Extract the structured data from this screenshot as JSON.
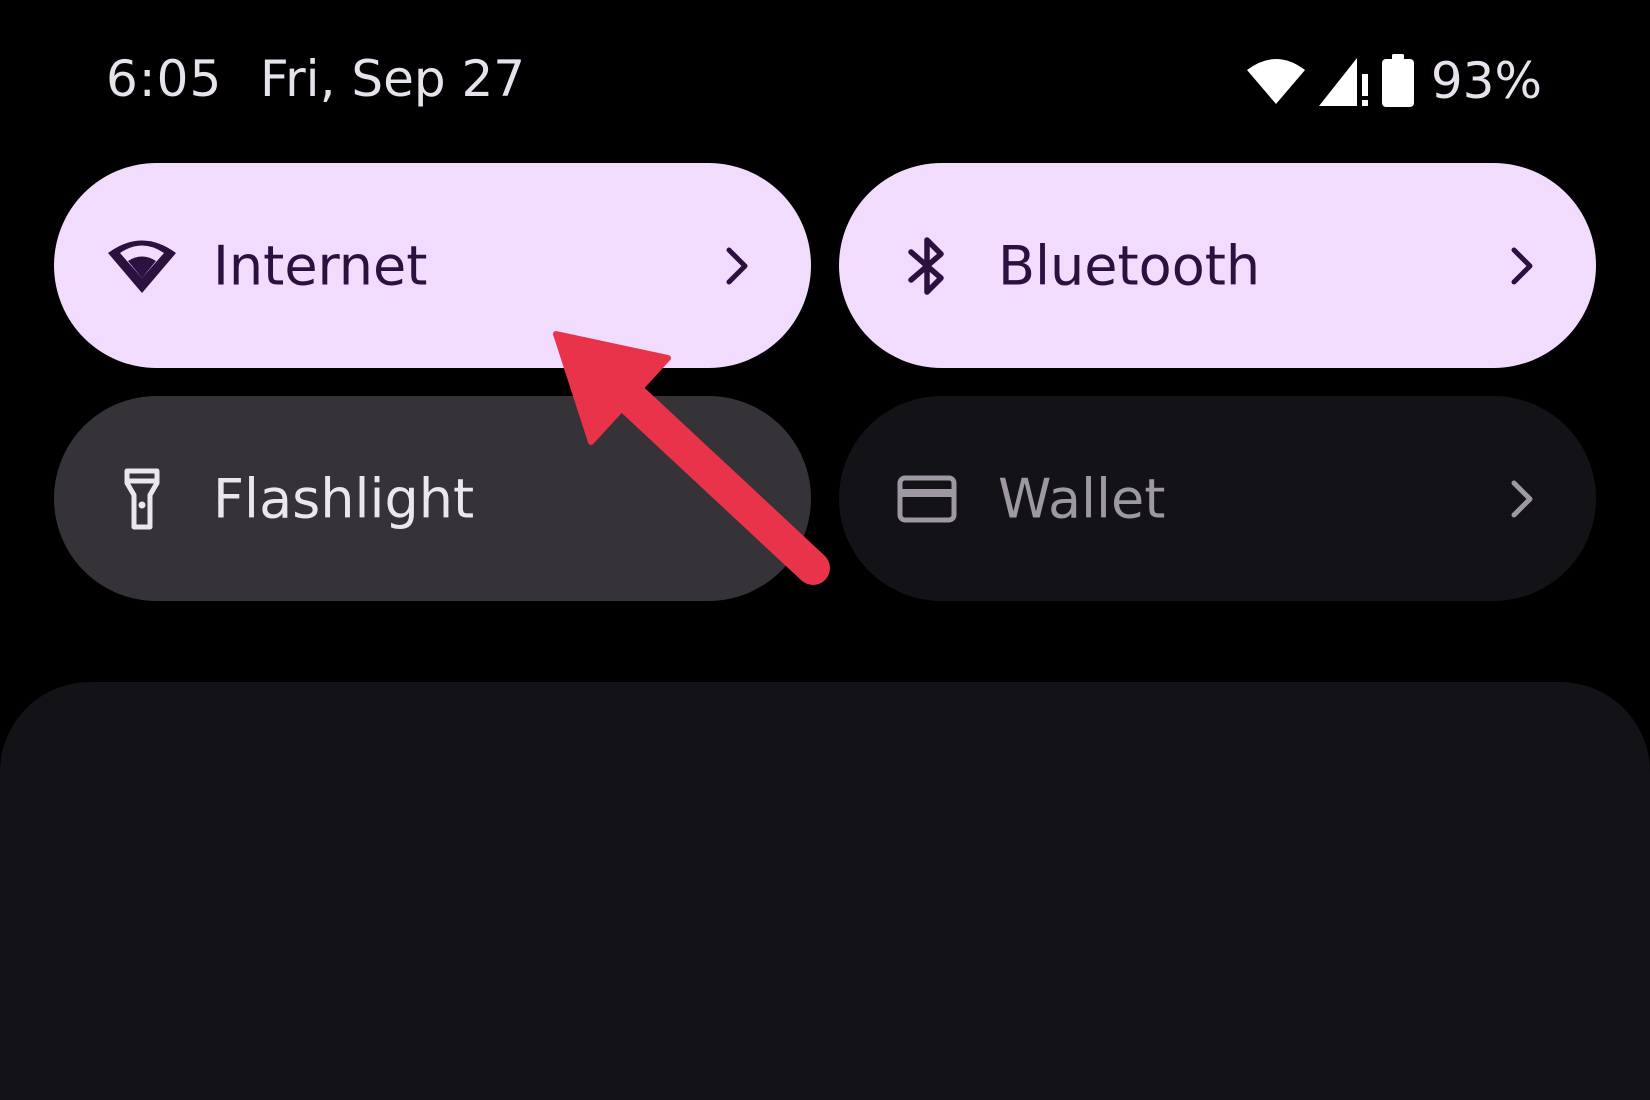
{
  "status_bar": {
    "time": "6:05",
    "date": "Fri, Sep 27",
    "battery_percent": "93%",
    "icons": [
      "wifi-icon",
      "cell-signal-icon",
      "battery-icon"
    ]
  },
  "tiles": [
    {
      "id": "internet",
      "label": "Internet",
      "icon": "wifi-icon",
      "state": "active",
      "has_chevron": true
    },
    {
      "id": "bluetooth",
      "label": "Bluetooth",
      "icon": "bluetooth-icon",
      "state": "active",
      "has_chevron": true
    },
    {
      "id": "flashlight",
      "label": "Flashlight",
      "icon": "flashlight-icon",
      "state": "inactive",
      "has_chevron": false
    },
    {
      "id": "wallet",
      "label": "Wallet",
      "icon": "wallet-icon",
      "state": "unavailable",
      "has_chevron": true
    }
  ],
  "annotation": {
    "type": "arrow",
    "color": "#e8334a",
    "points_to": "internet-tile"
  },
  "colors": {
    "active_tile": "#f1dcfe",
    "active_text": "#2a1140",
    "inactive_tile": "#353238",
    "unavailable_tile": "#131216",
    "background": "#000000"
  }
}
